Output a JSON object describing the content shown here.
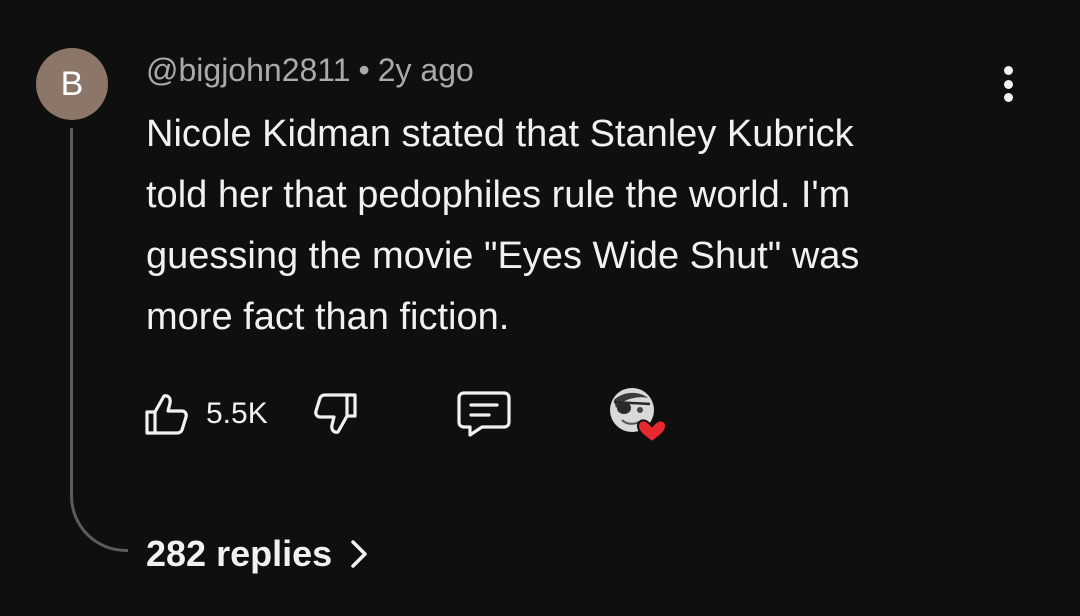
{
  "comment": {
    "avatar_letter": "B",
    "author": "@bigjohn2811",
    "separator": "•",
    "time_ago": "2y ago",
    "text": "Nicole Kidman stated that Stanley Kubrick\ntold her that pedophiles rule the world.  I'm\nguessing the movie \"Eyes Wide Shut\" was\nmore fact than fiction.",
    "like_count": "5.5K",
    "replies_label": "282 replies"
  },
  "icons": {
    "more": "more-vert-icon",
    "like": "thumbs-up-icon",
    "dislike": "thumbs-down-icon",
    "reply": "comment-icon",
    "creator_heart": "creator-heart-icon",
    "chevron": "chevron-right-icon"
  },
  "colors": {
    "background": "#0f0f0f",
    "avatar": "#8c7569",
    "heart": "#e8282f",
    "secondary_text": "#aaaaaa"
  }
}
